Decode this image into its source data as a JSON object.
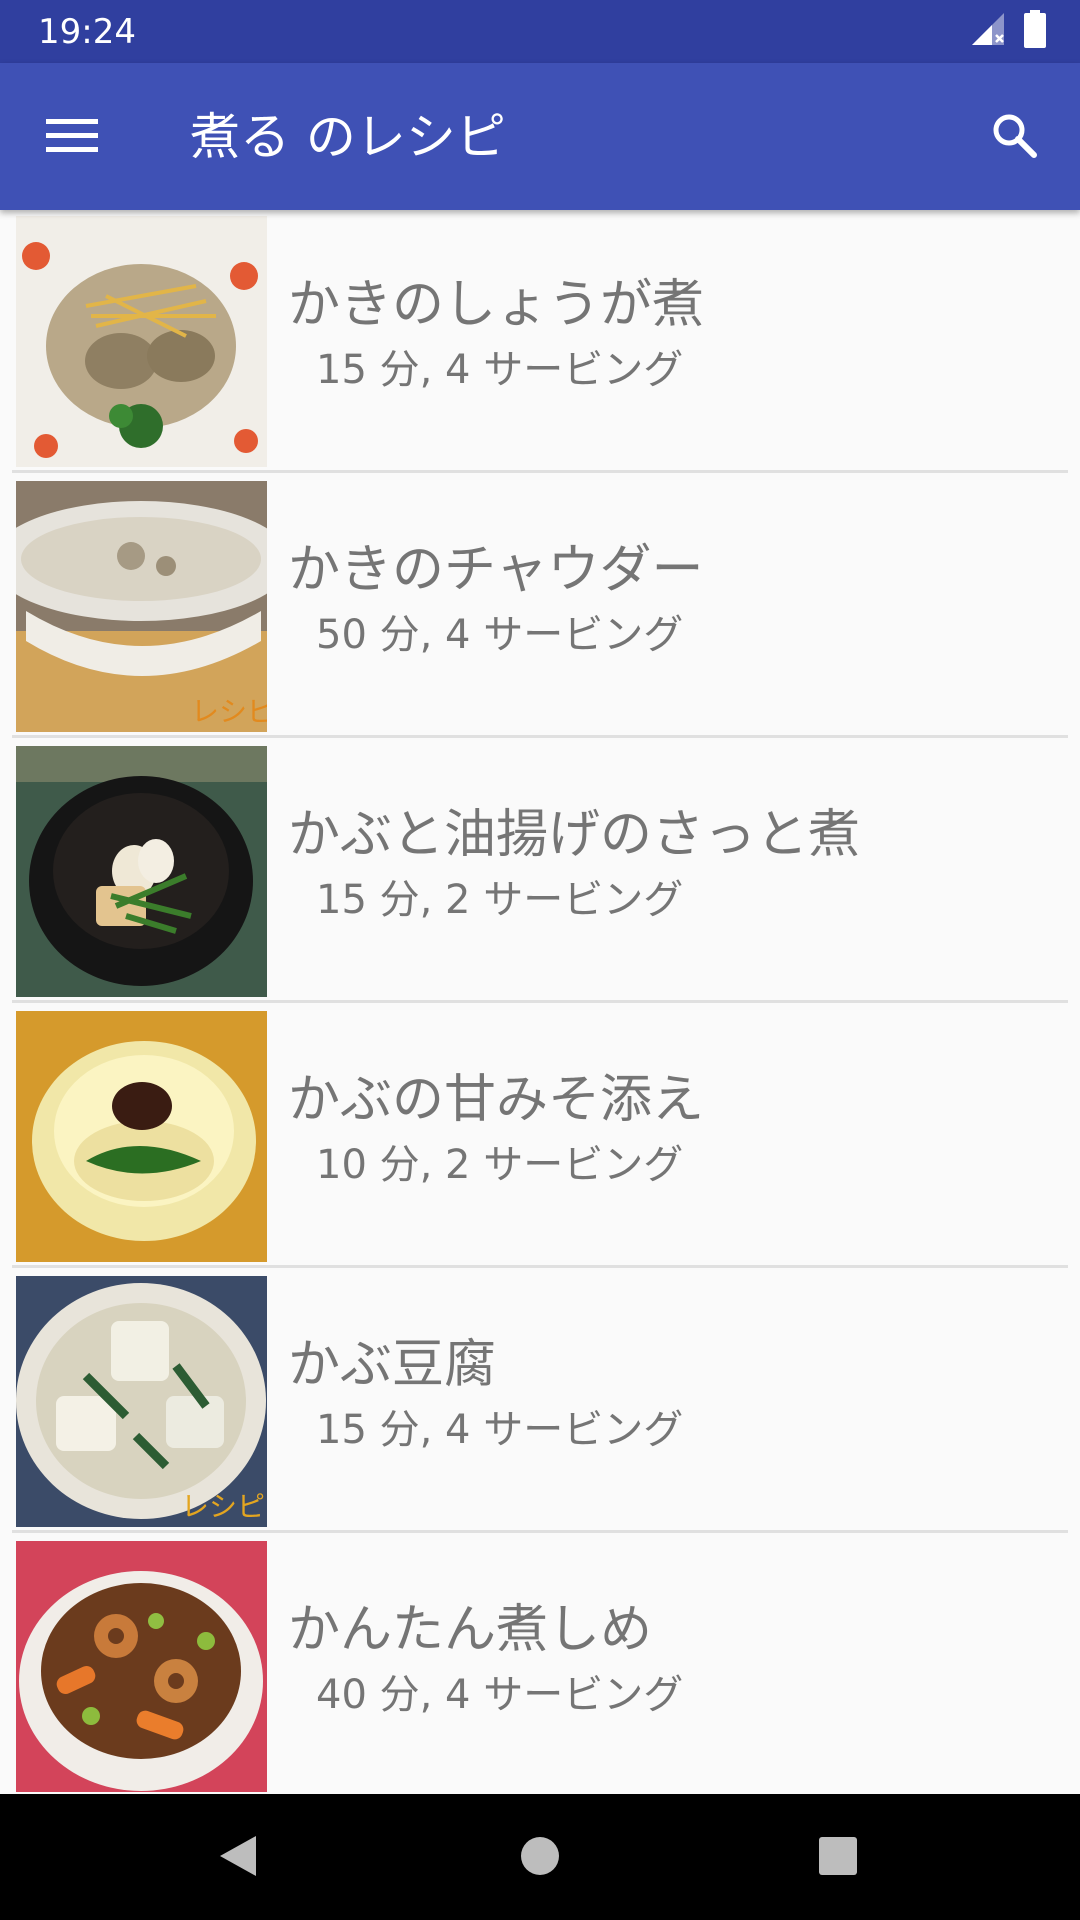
{
  "status_bar": {
    "time": "19:24",
    "icons": [
      "signal-no-data-icon",
      "battery-full-icon"
    ]
  },
  "app_bar": {
    "title": "煮る のレシピ",
    "menu_icon": "hamburger-menu-icon",
    "search_icon": "search-icon",
    "color": "#3f51b5",
    "status_color": "#303f9f"
  },
  "recipes": [
    {
      "name": "かきのしょうが煮",
      "meta": "15 分, 4 サービング",
      "image": "oyster-ginger-dish"
    },
    {
      "name": "かきのチャウダー",
      "meta": "50 分, 4 サービング",
      "image": "oyster-chowder-bowl"
    },
    {
      "name": "かぶと油揚げのさっと煮",
      "meta": "15 分, 2 サービング",
      "image": "turnip-fried-tofu-bowl"
    },
    {
      "name": "かぶの甘みそ添え",
      "meta": "10 分, 2 サービング",
      "image": "turnip-sweet-miso-bowl"
    },
    {
      "name": "かぶ豆腐",
      "meta": "15 分, 4 サービング",
      "image": "turnip-tofu-bowl"
    },
    {
      "name": "かんたん煮しめ",
      "meta": "40 分, 4 サービング",
      "image": "simmered-vegetables-bowl"
    }
  ],
  "nav_bar": {
    "back_icon": "back-triangle-icon",
    "home_icon": "home-circle-icon",
    "recents_icon": "recents-square-icon"
  }
}
